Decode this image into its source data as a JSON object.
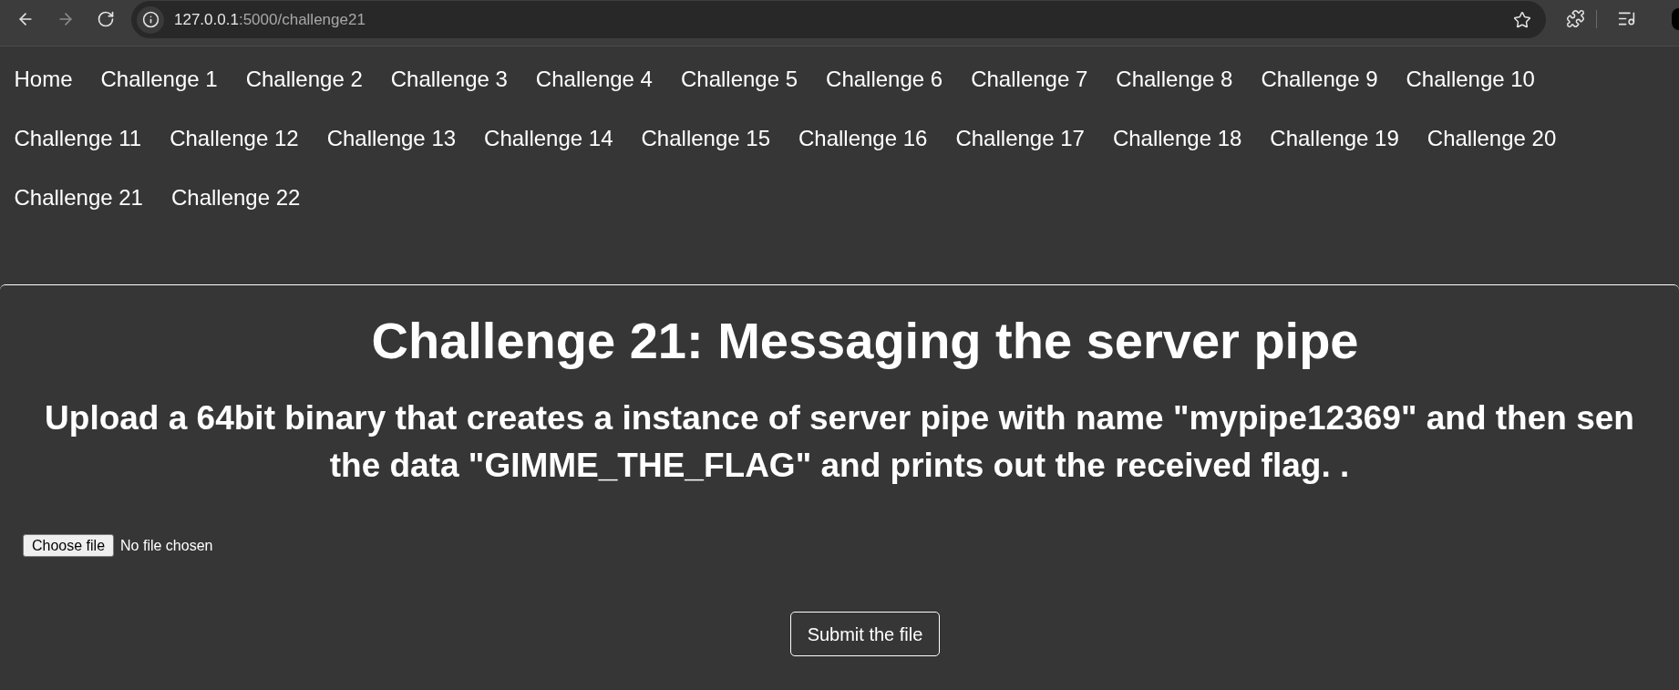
{
  "browser": {
    "nav_buttons": [
      {
        "kind": "back",
        "disabled": false
      },
      {
        "kind": "forward",
        "disabled": true
      },
      {
        "kind": "reload",
        "disabled": false
      }
    ],
    "url_host": "127.0.0.1",
    "url_path": ":5000/challenge21"
  },
  "nav": {
    "links": [
      "Home",
      "Challenge 1",
      "Challenge 2",
      "Challenge 3",
      "Challenge 4",
      "Challenge 5",
      "Challenge 6",
      "Challenge 7",
      "Challenge 8",
      "Challenge 9",
      "Challenge 10",
      "Challenge 11",
      "Challenge 12",
      "Challenge 13",
      "Challenge 14",
      "Challenge 15",
      "Challenge 16",
      "Challenge 17",
      "Challenge 18",
      "Challenge 19",
      "Challenge 20",
      "Challenge 21",
      "Challenge 22"
    ]
  },
  "challenge": {
    "title": "Challenge 21: Messaging the server pipe",
    "description_lines": [
      "Upload a 64bit binary that creates a instance of server pipe with name \"mypipe12369\" and then sen",
      "the data \"GIMME_THE_FLAG\" and prints out the received flag. ."
    ],
    "file_input": {
      "button": "Choose file",
      "status": "No file chosen"
    },
    "submit": "Submit the file"
  }
}
